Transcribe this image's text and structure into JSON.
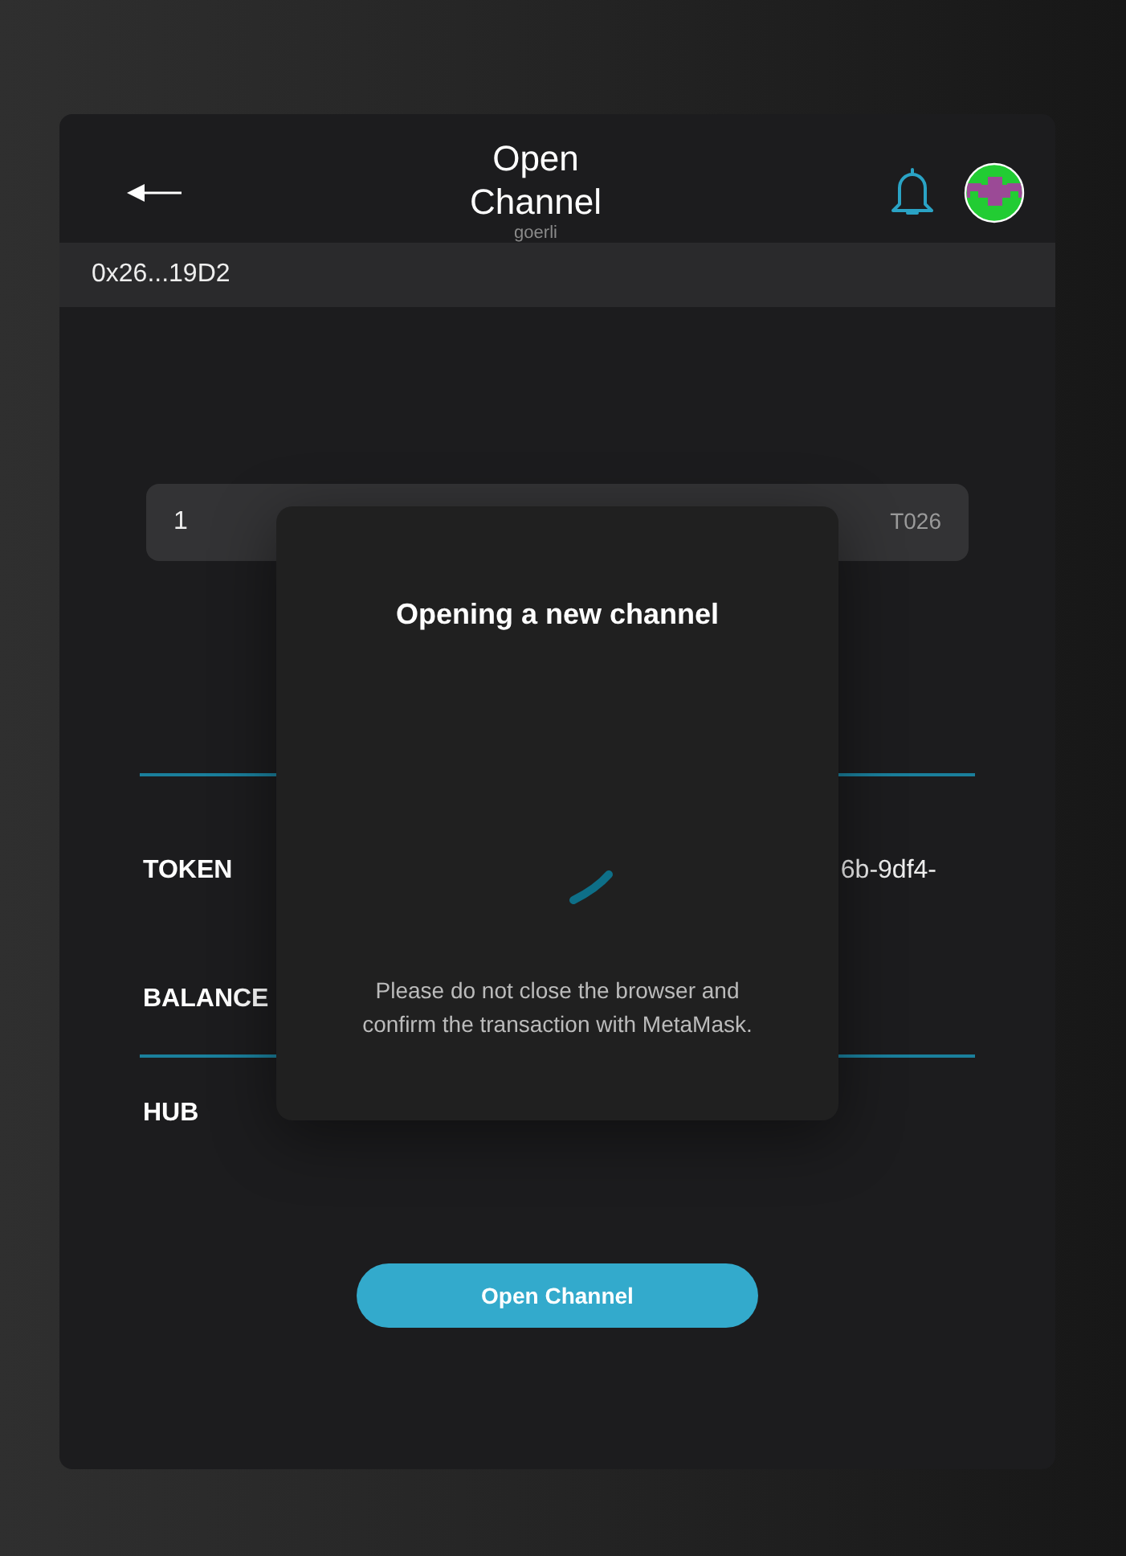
{
  "header": {
    "title": "Open Channel",
    "subtitle": "goerli"
  },
  "account": {
    "address": "0x26...19D2"
  },
  "amount_field": {
    "value": "1",
    "unit": "T026"
  },
  "details": [
    {
      "kind": "main",
      "label": "TOKEN",
      "value": "6b-9df4-"
    },
    {
      "kind": "main",
      "label": "BALANCE"
    },
    {
      "kind": "extra",
      "label": "HUB"
    }
  ],
  "primary_button": {
    "label": "Open Channel"
  },
  "dialog": {
    "title": "Opening a new channel",
    "message": "Please do not close the browser and confirm the transaction with MetaMask."
  }
}
